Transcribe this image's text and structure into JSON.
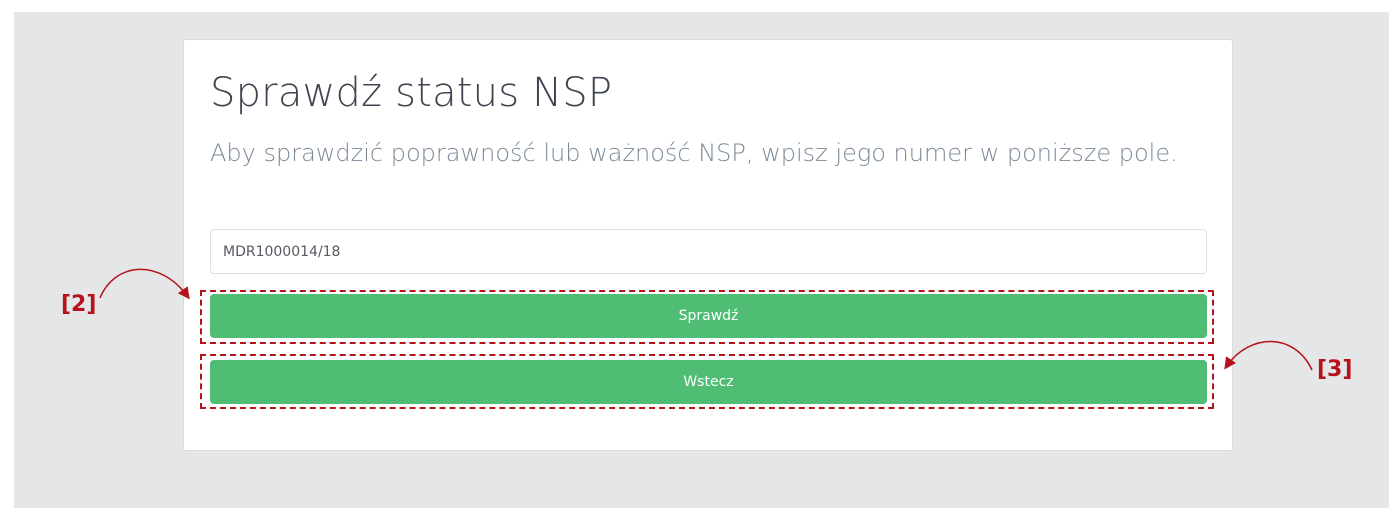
{
  "page": {
    "title": "Sprawdź status NSP",
    "subtitle": "Aby sprawdzić poprawność lub ważność NSP, wpisz jego numer w poniższe pole."
  },
  "form": {
    "nsp_value": "MDR1000014/18",
    "check_label": "Sprawdź",
    "back_label": "Wstecz"
  },
  "annotations": {
    "callout_2": "[2]",
    "callout_3": "[3]"
  },
  "colors": {
    "button_green": "#4fbd74",
    "annotation_red": "#b5121b",
    "background": "#e5e6e8"
  }
}
